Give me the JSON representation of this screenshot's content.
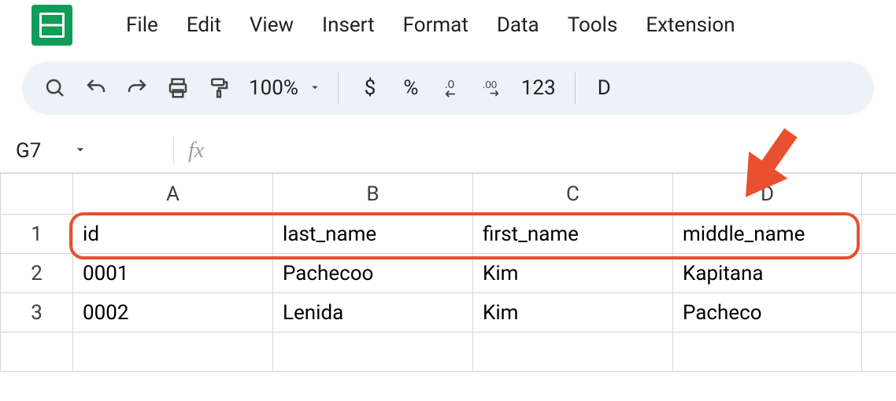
{
  "menu": {
    "items": [
      "File",
      "Edit",
      "View",
      "Insert",
      "Format",
      "Data",
      "Tools",
      "Extension"
    ]
  },
  "toolbar": {
    "zoom": "100%",
    "currency": "$",
    "percent": "%",
    "dec_decrease": ".0",
    "dec_increase": ".00",
    "num_format": "123",
    "font_hint": "D"
  },
  "namebox": {
    "ref": "G7",
    "fx": "fx"
  },
  "columns": [
    "A",
    "B",
    "C",
    "D",
    ""
  ],
  "rows": [
    {
      "n": "1",
      "cells": [
        "id",
        "last_name",
        "first_name",
        "middle_name",
        ""
      ]
    },
    {
      "n": "2",
      "cells": [
        "0001",
        "Pachecoo",
        "Kim",
        "Kapitana",
        ""
      ]
    },
    {
      "n": "3",
      "cells": [
        "0002",
        "Lenida",
        "Kim",
        "Pacheco",
        ""
      ]
    }
  ],
  "annotation": {
    "highlight_row": 1,
    "arrow_target_col": "D",
    "arrow_color": "#e8502f"
  },
  "chart_data": {
    "type": "table",
    "columns": [
      "id",
      "last_name",
      "first_name",
      "middle_name"
    ],
    "rows": [
      [
        "0001",
        "Pachecoo",
        "Kim",
        "Kapitana"
      ],
      [
        "0002",
        "Lenida",
        "Kim",
        "Pacheco"
      ]
    ]
  }
}
